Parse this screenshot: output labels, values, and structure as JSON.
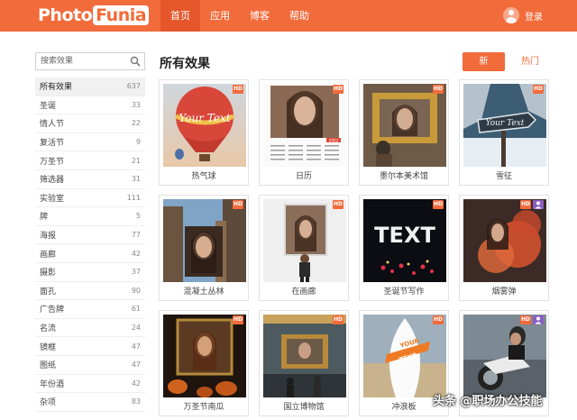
{
  "header": {
    "logo": {
      "part1": "Photo",
      "part2": "Funia"
    },
    "nav": [
      "首页",
      "应用",
      "博客",
      "帮助"
    ],
    "login": "登录"
  },
  "sidebar": {
    "search_placeholder": "搜索效果",
    "categories": [
      {
        "label": "所有效果",
        "count": "637"
      },
      {
        "label": "圣诞",
        "count": "33"
      },
      {
        "label": "情人节",
        "count": "22"
      },
      {
        "label": "复活节",
        "count": "9"
      },
      {
        "label": "万圣节",
        "count": "21"
      },
      {
        "label": "筛选器",
        "count": "31"
      },
      {
        "label": "实验室",
        "count": "111"
      },
      {
        "label": "牌",
        "count": "5"
      },
      {
        "label": "海报",
        "count": "77"
      },
      {
        "label": "画廊",
        "count": "42"
      },
      {
        "label": "摄影",
        "count": "37"
      },
      {
        "label": "面孔",
        "count": "90"
      },
      {
        "label": "广告牌",
        "count": "61"
      },
      {
        "label": "名流",
        "count": "24"
      },
      {
        "label": "镜框",
        "count": "47"
      },
      {
        "label": "图纸",
        "count": "47"
      },
      {
        "label": "年份酒",
        "count": "42"
      },
      {
        "label": "杂项",
        "count": "83"
      }
    ]
  },
  "main": {
    "title": "所有效果",
    "sort_new": "新",
    "sort_hot": "热门",
    "effects": [
      {
        "label": "热气球",
        "badge": "HD"
      },
      {
        "label": "日历",
        "badge": "HD",
        "calendar_year": "2022"
      },
      {
        "label": "墨尔本美术馆",
        "badge": "HD"
      },
      {
        "label": "雪征",
        "badge": "HD"
      },
      {
        "label": "混凝土丛林",
        "badge": "HD"
      },
      {
        "label": "在画廊",
        "badge": "HD"
      },
      {
        "label": "圣诞节写作",
        "badge": "HD"
      },
      {
        "label": "烟雾弹",
        "badge": "HD"
      },
      {
        "label": "万圣节南瓜",
        "badge": "HD"
      },
      {
        "label": "国立博物馆",
        "badge": "HD"
      },
      {
        "label": "冲浪板",
        "badge": "HD"
      },
      {
        "label": "",
        "badge": "HD"
      }
    ],
    "sample_texts": {
      "balloon": "Your Text",
      "sign": "Your Text",
      "neon": "TEXT",
      "surf_line1": "YOUR",
      "surf_line2": "TEXT"
    }
  },
  "watermark": "头条 @职场办公技能",
  "colors": {
    "accent": "#f26b3a",
    "accent_dark": "#e5572a"
  }
}
